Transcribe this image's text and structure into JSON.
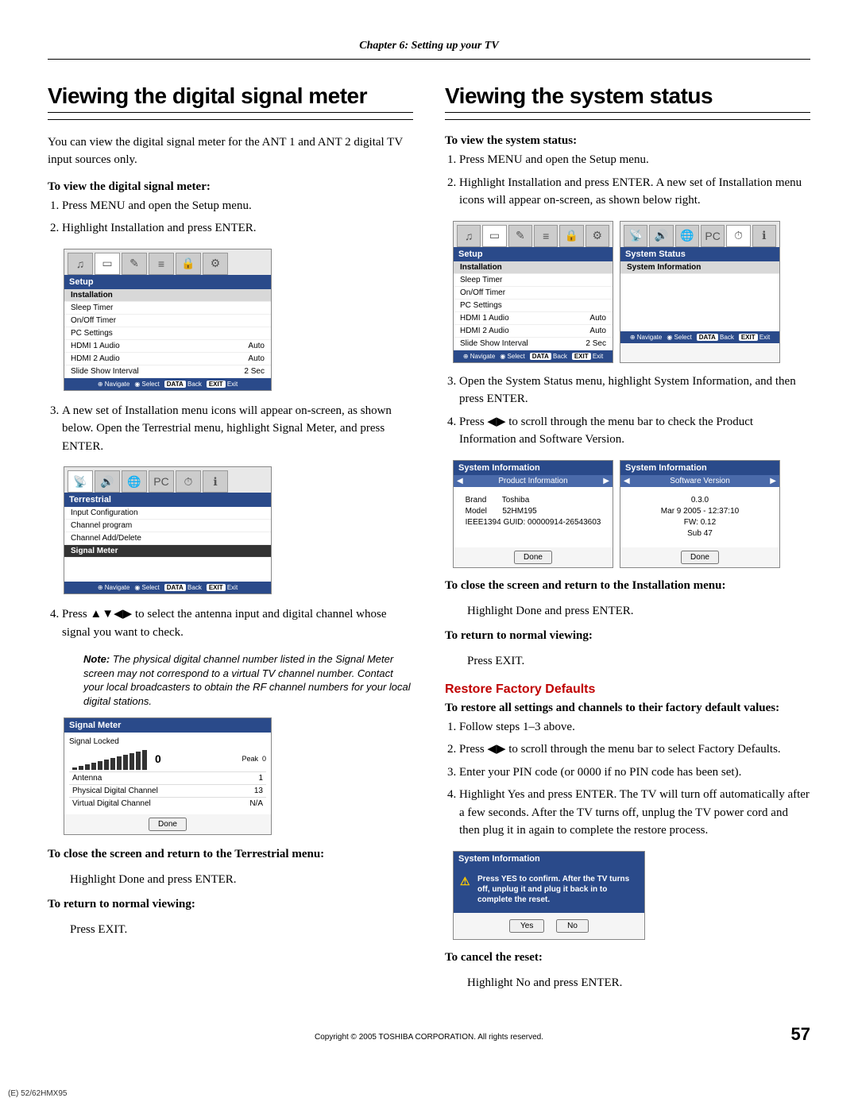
{
  "chapter": "Chapter 6: Setting up your TV",
  "left": {
    "title": "Viewing the digital signal meter",
    "intro": "You can view the digital signal meter for the ANT 1 and ANT 2 digital TV input sources only.",
    "sub1": "To view the digital signal meter:",
    "step1": "Press MENU and open the Setup menu.",
    "step2": "Highlight Installation and press ENTER.",
    "menu1": {
      "title": "Setup",
      "rows": [
        [
          "Installation",
          ""
        ],
        [
          "Sleep Timer",
          ""
        ],
        [
          "On/Off Timer",
          ""
        ],
        [
          "PC Settings",
          ""
        ],
        [
          "HDMI 1 Audio",
          "Auto"
        ],
        [
          "HDMI 2 Audio",
          "Auto"
        ],
        [
          "Slide Show Interval",
          "2 Sec"
        ]
      ],
      "footer": [
        "Navigate",
        "Select",
        "Back",
        "Exit"
      ]
    },
    "step3": "A new set of Installation menu icons will appear on-screen, as shown below. Open the Terrestrial menu, highlight Signal Meter, and press ENTER.",
    "menu2": {
      "title": "Terrestrial",
      "rows": [
        [
          "Input Configuration",
          ""
        ],
        [
          "Channel program",
          ""
        ],
        [
          "Channel Add/Delete",
          ""
        ],
        [
          "Signal Meter",
          ""
        ]
      ],
      "footer": [
        "Navigate",
        "Select",
        "Back",
        "Exit"
      ]
    },
    "step4_pre": "Press ",
    "step4_post": " to select the antenna input and digital channel whose signal you want to check.",
    "note_label": "Note:",
    "note": " The physical digital channel number listed in the Signal Meter screen may not correspond to a virtual TV channel number. Contact your local broadcasters to obtain the RF channel numbers for your local digital stations.",
    "signal_meter": {
      "title": "Signal Meter",
      "locked": "Signal Locked",
      "value": "0",
      "peak_label": "Peak",
      "peak_value": "0",
      "rows": [
        [
          "Antenna",
          "1"
        ],
        [
          "Physical Digital Channel",
          "13"
        ],
        [
          "Virtual Digital Channel",
          "N/A"
        ]
      ],
      "done": "Done"
    },
    "close_head": "To close the screen and return to the Terrestrial menu:",
    "close_body": "Highlight Done and press ENTER.",
    "return_head": "To return to normal viewing:",
    "return_body": "Press EXIT."
  },
  "right": {
    "title": "Viewing the system status",
    "sub1": "To view the system status:",
    "step1": "Press MENU and open the Setup menu.",
    "step2": "Highlight Installation and press ENTER. A new set of Installation menu icons will appear on-screen, as shown below right.",
    "dual_left": {
      "title": "Setup",
      "rows": [
        [
          "Installation",
          ""
        ],
        [
          "Sleep Timer",
          ""
        ],
        [
          "On/Off Timer",
          ""
        ],
        [
          "PC Settings",
          ""
        ],
        [
          "HDMI 1 Audio",
          "Auto"
        ],
        [
          "HDMI 2 Audio",
          "Auto"
        ],
        [
          "Slide Show Interval",
          "2 Sec"
        ]
      ]
    },
    "dual_right": {
      "title": "System Status",
      "rows": [
        [
          "System Information",
          ""
        ]
      ]
    },
    "dual_footer": [
      "Navigate",
      "Select",
      "Back",
      "Exit"
    ],
    "step3": "Open the System Status menu, highlight System Information, and then press ENTER.",
    "step4_pre": "Press ",
    "step4_post": " to scroll through the menu bar to check the Product Information and Software Version.",
    "sysinfo_head": "System Information",
    "prod_sub": "Product Information",
    "prod_body": {
      "l1a": "Brand",
      "l1b": "Toshiba",
      "l2a": "Model",
      "l2b": "52HM195",
      "l3a": "IEEE1394 GUID:",
      "l3b": "00000914-26543603"
    },
    "soft_sub": "Software Version",
    "soft_body": {
      "l1": "0.3.0",
      "l2": "Mar 9 2005 - 12:37:10",
      "l3": "FW: 0.12",
      "l4": "Sub 47"
    },
    "done": "Done",
    "close_head": "To close the screen and return to the Installation menu:",
    "close_body": "Highlight Done and press ENTER.",
    "return_head": "To return to normal viewing:",
    "return_body": "Press EXIT.",
    "restore_head": "Restore Factory Defaults",
    "restore_sub": "To restore all settings and channels to their factory default values:",
    "rstep1": "Follow steps 1–3 above.",
    "rstep2_pre": "Press ",
    "rstep2_post": " to scroll through the menu bar to select Factory Defaults.",
    "rstep3": "Enter your PIN code (or 0000 if no PIN code has been set).",
    "rstep4": "Highlight Yes and press ENTER. The TV will turn off automatically after a few seconds. After the TV turns off, unplug the TV power cord and then plug it in again to complete the restore process.",
    "confirm": {
      "head": "System Information",
      "msg": "Press YES to confirm. After the TV turns off, unplug it and plug it back in to complete the reset.",
      "yes": "Yes",
      "no": "No"
    },
    "cancel_head": "To cancel the reset:",
    "cancel_body": "Highlight No and press ENTER."
  },
  "footer": {
    "copyright": "Copyright © 2005 TOSHIBA CORPORATION. All rights reserved.",
    "page": "57",
    "crop": "(E) 52/62HMX95"
  }
}
